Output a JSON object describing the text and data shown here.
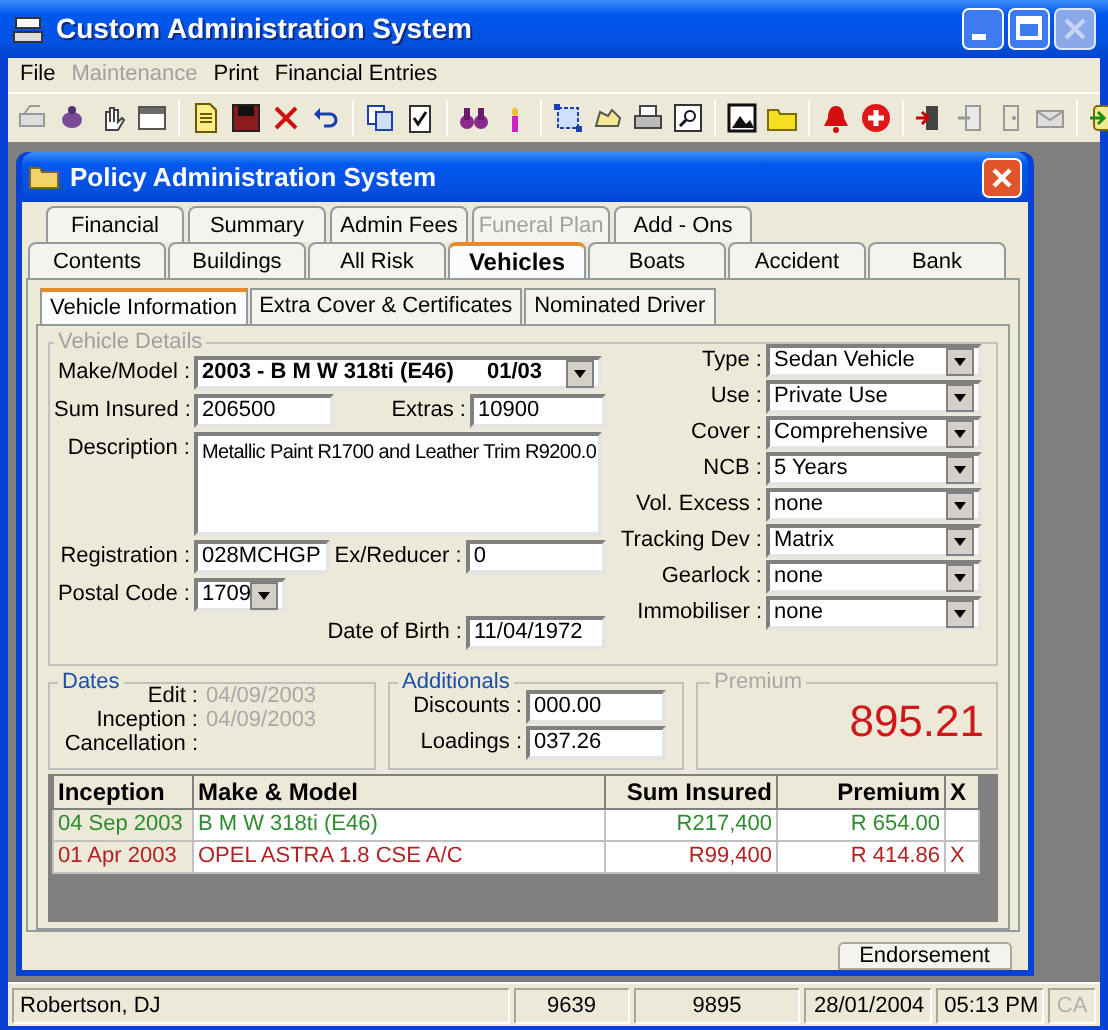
{
  "window": {
    "title": "Custom Administration System"
  },
  "menu": [
    {
      "label": "File",
      "disabled": false
    },
    {
      "label": "Maintenance",
      "disabled": true
    },
    {
      "label": "Print",
      "disabled": false
    },
    {
      "label": "Financial Entries",
      "disabled": false
    }
  ],
  "policy_window": {
    "title": "Policy Administration System",
    "tab_rows": [
      {
        "tabs": [
          {
            "label": "Financial",
            "selected": false,
            "disabled": false
          },
          {
            "label": "Summary",
            "selected": false,
            "disabled": false
          },
          {
            "label": "Admin Fees",
            "selected": false,
            "disabled": false
          },
          {
            "label": "Funeral Plan",
            "selected": false,
            "disabled": true
          },
          {
            "label": "Add - Ons",
            "selected": false,
            "disabled": false
          }
        ]
      },
      {
        "tabs": [
          {
            "label": "Contents",
            "selected": false,
            "disabled": false
          },
          {
            "label": "Buildings",
            "selected": false,
            "disabled": false
          },
          {
            "label": "All Risk",
            "selected": false,
            "disabled": false
          },
          {
            "label": "Vehicles",
            "selected": true,
            "disabled": false
          },
          {
            "label": "Boats",
            "selected": false,
            "disabled": false
          },
          {
            "label": "Accident",
            "selected": false,
            "disabled": false
          },
          {
            "label": "Bank",
            "selected": false,
            "disabled": false
          }
        ]
      }
    ],
    "subtabs": [
      {
        "label": "Vehicle Information",
        "selected": true
      },
      {
        "label": "Extra Cover & Certificates",
        "selected": false
      },
      {
        "label": "Nominated Driver",
        "selected": false
      }
    ],
    "vehicle_details": {
      "legend": "Vehicle Details",
      "make_model": {
        "label": "Make/Model :",
        "value": "2003 - B M W 318ti (E46)",
        "date": "01/03"
      },
      "sum_insured": {
        "label": "Sum Insured :",
        "value": "206500"
      },
      "extras": {
        "label": "Extras :",
        "value": "10900"
      },
      "description": {
        "label": "Description :",
        "value": "Metallic Paint R1700 and Leather Trim R9200.0"
      },
      "registration": {
        "label": "Registration :",
        "value": "028MCHGP"
      },
      "ex_reducer": {
        "label": "Ex/Reducer :",
        "value": "0"
      },
      "postal_code": {
        "label": "Postal Code :",
        "value": "1709"
      },
      "date_of_birth": {
        "label": "Date of Birth :",
        "value": "11/04/1972"
      },
      "options": [
        {
          "label": "Type :",
          "value": "Sedan Vehicle"
        },
        {
          "label": "Use :",
          "value": "Private Use"
        },
        {
          "label": "Cover :",
          "value": "Comprehensive"
        },
        {
          "label": "NCB :",
          "value": "5 Years"
        },
        {
          "label": "Vol. Excess :",
          "value": "none"
        },
        {
          "label": "Tracking Dev :",
          "value": "Matrix"
        },
        {
          "label": "Gearlock :",
          "value": "none"
        },
        {
          "label": "Immobiliser :",
          "value": "none"
        }
      ]
    },
    "dates": {
      "legend": "Dates",
      "rows": [
        {
          "label": "Edit :",
          "value": "04/09/2003"
        },
        {
          "label": "Inception :",
          "value": "04/09/2003"
        },
        {
          "label": "Cancellation :"
        }
      ]
    },
    "additionals": {
      "legend": "Additionals",
      "rows": [
        {
          "label": "Discounts :",
          "value": "000.00"
        },
        {
          "label": "Loadings :",
          "value": "037.26"
        }
      ]
    },
    "premium": {
      "legend": "Premium",
      "value": "895.21"
    },
    "table": {
      "columns": [
        "Inception",
        "Make & Model",
        "Sum Insured",
        "Premium",
        "X"
      ],
      "rows": [
        {
          "color": "#2e8b2e",
          "cells": [
            "04 Sep 2003",
            "B M W 318ti (E46)",
            "R217,400",
            "R 654.00"
          ]
        },
        {
          "color": "#b22222",
          "cells": [
            "01 Apr 2003",
            "OPEL ASTRA 1.8 CSE A/C",
            "R99,400",
            "R 414.86",
            "X"
          ]
        }
      ]
    },
    "buttons": [
      {
        "label": "Endorsement"
      }
    ]
  },
  "status_bar": [
    {
      "text": "Robertson, DJ",
      "disabled": false
    },
    {
      "text": "9639",
      "disabled": false
    },
    {
      "text": "9895",
      "disabled": false
    },
    {
      "text": "28/01/2004",
      "disabled": false
    },
    {
      "text": "05:13 PM",
      "disabled": false
    },
    {
      "text": "CA",
      "disabled": true
    }
  ]
}
